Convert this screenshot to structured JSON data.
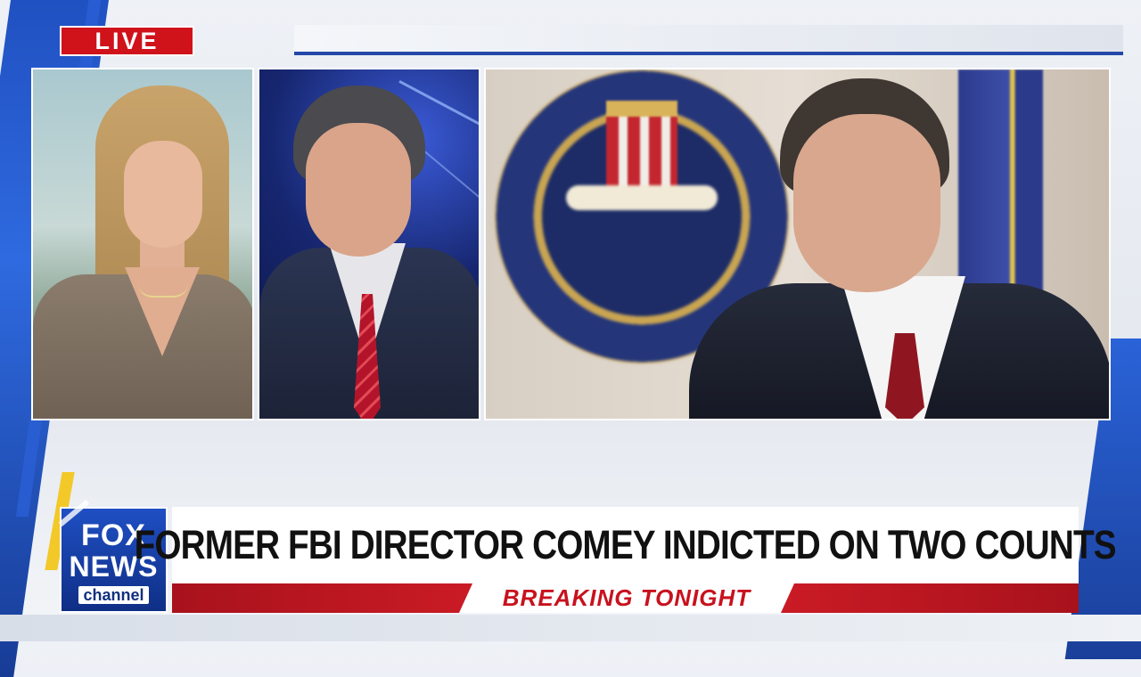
{
  "badge": {
    "live": "LIVE"
  },
  "network": {
    "logo_line1": "FOX",
    "logo_line2": "NEWS",
    "logo_line3": "channel"
  },
  "lower_third": {
    "headline": "FORMER FBI DIRECTOR COMEY INDICTED ON TWO COUNTS",
    "banner": "BREAKING TONIGHT"
  },
  "colors": {
    "live_red": "#d0121b",
    "fox_blue": "#1f4fc3",
    "banner_red": "#d11d27"
  }
}
